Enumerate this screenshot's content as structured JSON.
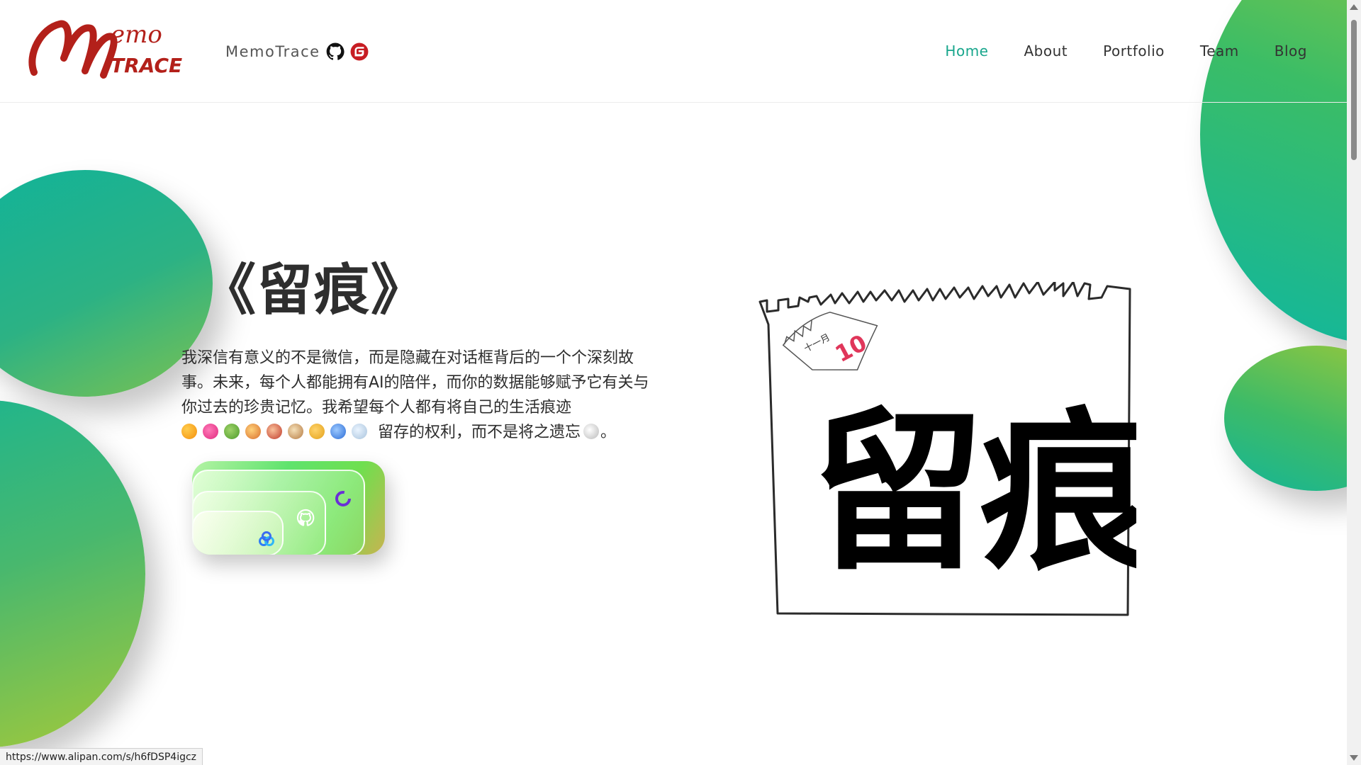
{
  "header": {
    "logo": {
      "text_main": "M",
      "text_emo": "emo",
      "text_trace": "TRACE",
      "color": "#b3201a"
    },
    "brand_name": "MemoTrace",
    "icons": [
      "github-icon",
      "gitee-icon"
    ]
  },
  "nav": {
    "items": [
      "Home",
      "About",
      "Portfolio",
      "Team",
      "Blog"
    ],
    "active": "Home",
    "active_color": "#18a68c"
  },
  "hero": {
    "title": "《留痕》",
    "text_main": "我深信有意义的不是微信，而是隐藏在对话框背后的一个个深刻故事。未来，每个人都能拥有AI的陪伴，而你的数据能够赋予它有关与你过去的珍贵记忆。我希望每个人都有将自己的生活痕迹",
    "emojis": [
      "people-holding-hands-emoji",
      "t-shirt-emoji",
      "salad-emoji",
      "house-emoji",
      "cyclist-emoji",
      "bubble-tea-emoji",
      "dancer-emoji",
      "bed-emoji",
      "bathtub-emoji"
    ],
    "text_tail": "留存的权利，而不是将之遗忘",
    "skull": "skull-emoji",
    "text_end": "。"
  },
  "app_card": {
    "icons": [
      "sync-icon",
      "github-icon",
      "baidu-netdisk-icon"
    ]
  },
  "illustration": {
    "calendar_month": "十一月",
    "calendar_day": "10",
    "big_text": "留痕"
  },
  "status_url": "https://www.alipan.com/s/h6fDSP4igcz",
  "colors": {
    "accent": "#18a68c",
    "blob_teal": "#10b39a",
    "blob_green": "#9bc83c"
  }
}
